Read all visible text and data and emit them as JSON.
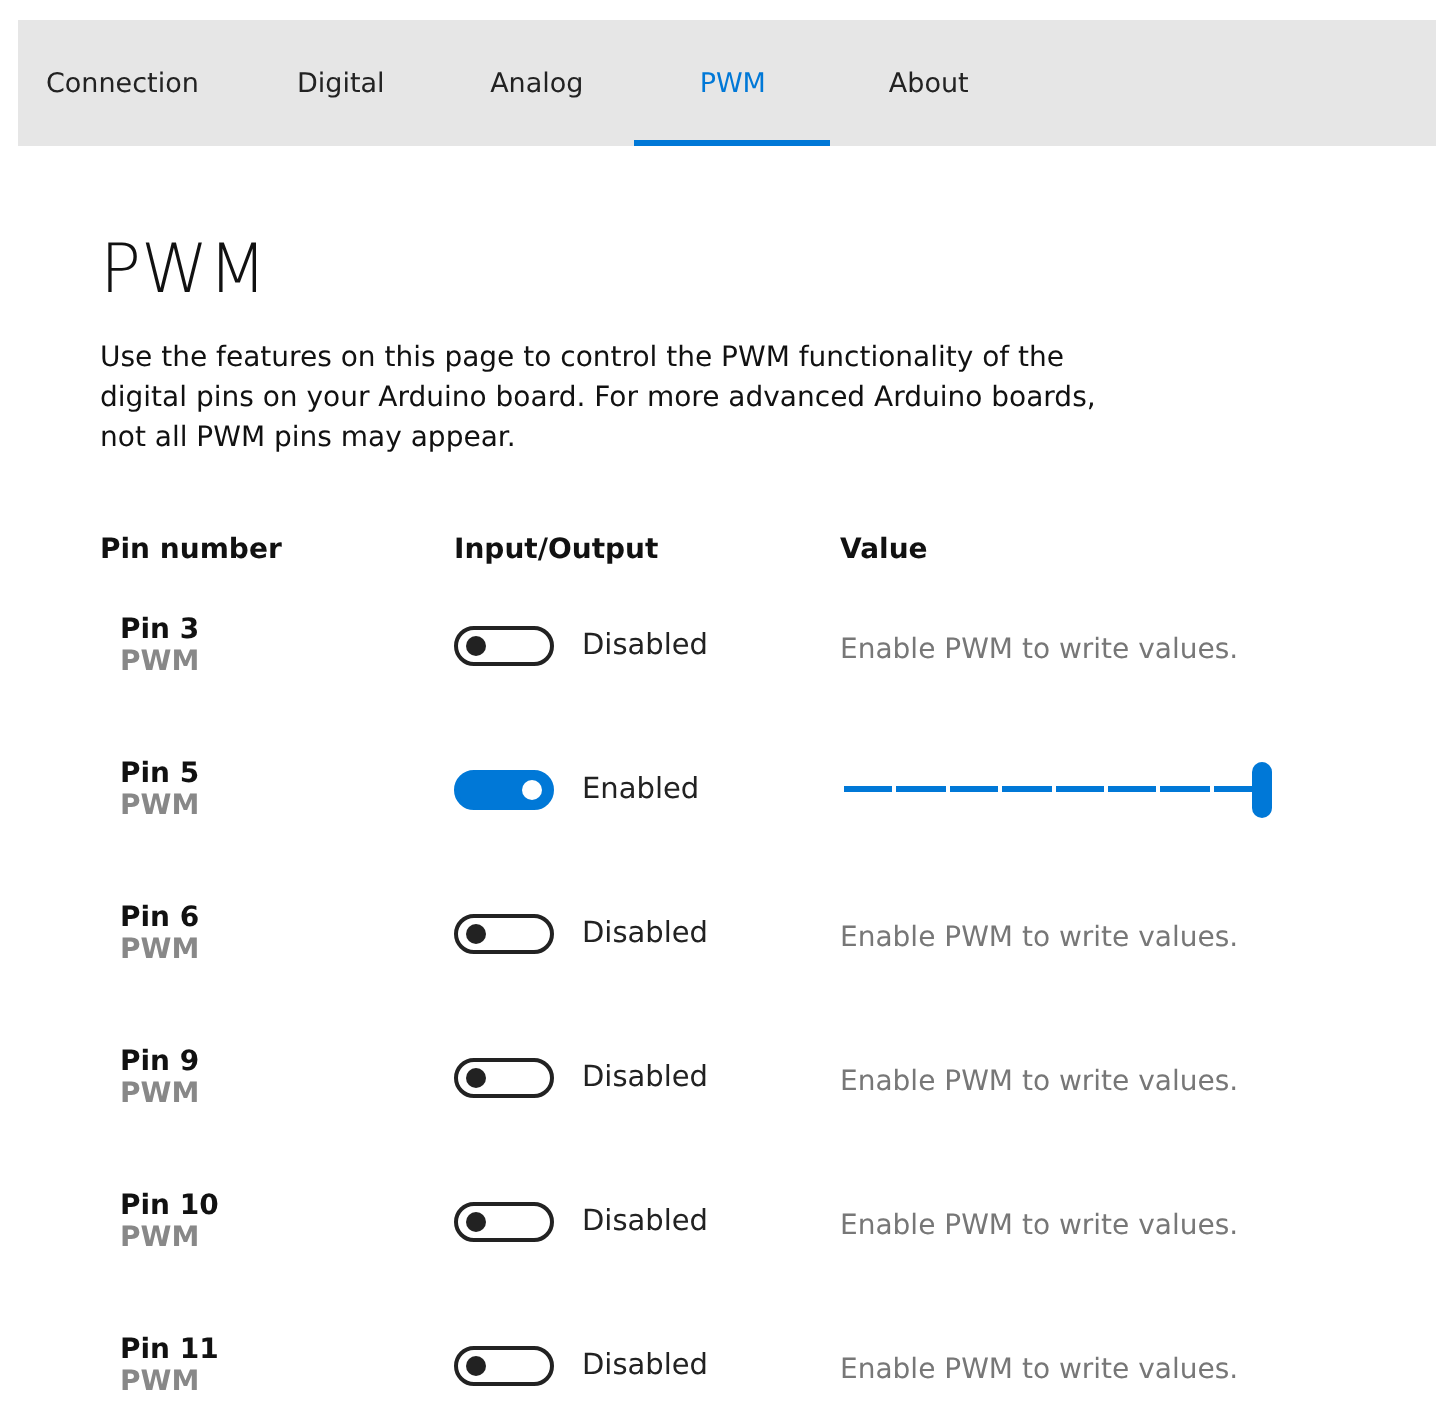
{
  "tabs": [
    {
      "label": "Connection",
      "selected": false
    },
    {
      "label": "Digital",
      "selected": false
    },
    {
      "label": "Analog",
      "selected": false
    },
    {
      "label": "PWM",
      "selected": true
    },
    {
      "label": "About",
      "selected": false
    }
  ],
  "heading": "PWM",
  "description": "Use the features on this page to control the PWM functionality of the digital pins on your Arduino board. For more advanced Arduino boards, not all PWM pins may appear.",
  "table": {
    "columns": [
      "Pin number",
      "Input/Output",
      "Value"
    ],
    "rows": [
      {
        "pin": "Pin 3",
        "type": "PWM",
        "on": false,
        "state": "Disabled",
        "hint": "Enable PWM to write values."
      },
      {
        "pin": "Pin 5",
        "type": "PWM",
        "on": true,
        "state": "Enabled",
        "level": 1
      },
      {
        "pin": "Pin 6",
        "type": "PWM",
        "on": false,
        "state": "Disabled",
        "hint": "Enable PWM to write values."
      },
      {
        "pin": "Pin 9",
        "type": "PWM",
        "on": false,
        "state": "Disabled",
        "hint": "Enable PWM to write values."
      },
      {
        "pin": "Pin 10",
        "type": "PWM",
        "on": false,
        "state": "Disabled",
        "hint": "Enable PWM to write values."
      },
      {
        "pin": "Pin 11",
        "type": "PWM",
        "on": false,
        "state": "Disabled",
        "hint": "Enable PWM to write values."
      }
    ]
  }
}
